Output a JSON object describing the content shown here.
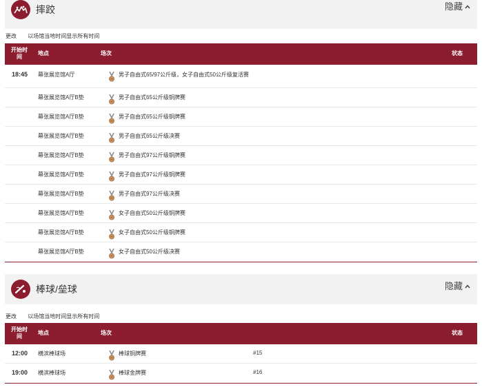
{
  "sports": [
    {
      "title": "摔跤",
      "logo_icon": "wrestling-pictogram",
      "hide_label": "隐藏",
      "change_label": "更改",
      "timezone_label": "以场馆当地时间显示所有时间",
      "columns": {
        "time": "开始时间",
        "venue": "地点",
        "event": "场次",
        "status": "状态"
      },
      "rows": [
        {
          "time": "18:45",
          "venue": "幕张展览馆A厅",
          "event": "男子自由式65/97公斤级，女子自由式50公斤级复活赛",
          "num": ""
        },
        {
          "time": "",
          "venue": "幕张展览馆A厅B垫",
          "event": "男子自由式65公斤级铜牌赛",
          "num": ""
        },
        {
          "time": "",
          "venue": "幕张展览馆A厅B垫",
          "event": "男子自由式65公斤级铜牌赛",
          "num": ""
        },
        {
          "time": "",
          "venue": "幕张展览馆A厅B垫",
          "event": "男子自由式65公斤级决赛",
          "num": ""
        },
        {
          "time": "",
          "venue": "幕张展览馆A厅B垫",
          "event": "男子自由式97公斤级铜牌赛",
          "num": ""
        },
        {
          "time": "",
          "venue": "幕张展览馆A厅B垫",
          "event": "男子自由式97公斤级铜牌赛",
          "num": ""
        },
        {
          "time": "",
          "venue": "幕张展览馆A厅B垫",
          "event": "男子自由式97公斤级决赛",
          "num": ""
        },
        {
          "time": "",
          "venue": "幕张展览馆A厅B垫",
          "event": "女子自由式50公斤级铜牌赛",
          "num": ""
        },
        {
          "time": "",
          "venue": "幕张展览馆A厅B垫",
          "event": "女子自由式50公斤级铜牌赛",
          "num": ""
        },
        {
          "time": "",
          "venue": "幕张展览馆A厅B垫",
          "event": "女子自由式50公斤级决赛",
          "num": ""
        }
      ]
    },
    {
      "title": "棒球/垒球",
      "logo_icon": "baseball-pictogram",
      "hide_label": "隐藏",
      "change_label": "更改",
      "timezone_label": "以场馆当地时间显示所有时间",
      "columns": {
        "time": "开始时间",
        "venue": "地点",
        "event": "场次",
        "status": "状态"
      },
      "rows": [
        {
          "time": "12:00",
          "venue": "横滨棒球场",
          "event": "棒球铜牌赛",
          "num": "#15"
        },
        {
          "time": "19:00",
          "venue": "横滨棒球场",
          "event": "棒球金牌赛",
          "num": "#16"
        }
      ]
    }
  ],
  "colors": {
    "accent": "#8b1d2f",
    "header_bg": "#f2f2f2",
    "medal": "#b07a4a"
  }
}
